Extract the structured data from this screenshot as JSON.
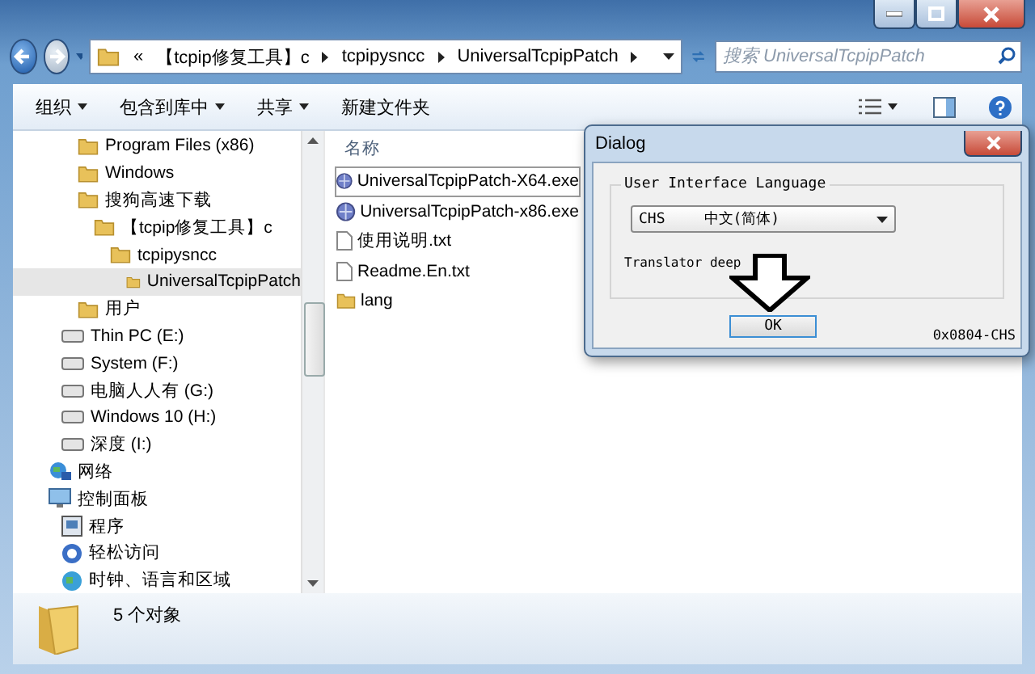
{
  "address": {
    "overflow": "«",
    "crumbs": [
      "【tcpip修复工具】c",
      "tcpipysncc",
      "UniversalTcpipPatch"
    ]
  },
  "search": {
    "placeholder": "搜索 UniversalTcpipPatch"
  },
  "toolbar": [
    {
      "label": "组织",
      "dropdown": true
    },
    {
      "label": "包含到库中",
      "dropdown": true
    },
    {
      "label": "共享",
      "dropdown": true
    },
    {
      "label": "新建文件夹",
      "dropdown": false
    }
  ],
  "sidebar": {
    "items": [
      {
        "kind": "folder",
        "label": "Program Files (x86)",
        "selected": false
      },
      {
        "kind": "folder",
        "label": "Windows",
        "selected": false
      },
      {
        "kind": "folder",
        "label": "搜狗高速下载",
        "selected": false,
        "children": [
          {
            "kind": "folder",
            "label": "【tcpip修复工具】c",
            "selected": false,
            "children": [
              {
                "kind": "folder",
                "label": "tcpipysncc",
                "selected": false,
                "children": [
                  {
                    "kind": "folder",
                    "label": "UniversalTcpipPatch",
                    "selected": true
                  }
                ]
              }
            ]
          }
        ]
      },
      {
        "kind": "folder",
        "label": "用户",
        "selected": false
      },
      {
        "kind": "drive",
        "label": "Thin PC (E:)",
        "selected": false
      },
      {
        "kind": "drive",
        "label": "System (F:)",
        "selected": false
      },
      {
        "kind": "drive",
        "label": "电脑人人有 (G:)",
        "selected": false
      },
      {
        "kind": "drive",
        "label": "Windows 10 (H:)",
        "selected": false
      },
      {
        "kind": "drive",
        "label": "深度 (I:)",
        "selected": false
      },
      {
        "kind": "network",
        "label": "网络",
        "selected": false
      },
      {
        "kind": "control",
        "label": "控制面板",
        "selected": false,
        "children": [
          {
            "kind": "programs",
            "label": "程序",
            "selected": false
          },
          {
            "kind": "access",
            "label": "轻松访问",
            "selected": false
          },
          {
            "kind": "clock",
            "label": "时钟、语言和区域",
            "selected": false
          }
        ]
      }
    ]
  },
  "columns": [
    "名称"
  ],
  "files": [
    {
      "kind": "exe",
      "name": "UniversalTcpipPatch-X64.exe",
      "selected": true
    },
    {
      "kind": "exe",
      "name": "UniversalTcpipPatch-x86.exe",
      "selected": false
    },
    {
      "kind": "txt",
      "name": "使用说明.txt",
      "selected": false
    },
    {
      "kind": "txt",
      "name": "Readme.En.txt",
      "selected": false
    },
    {
      "kind": "folder",
      "name": "lang",
      "selected": false
    }
  ],
  "dialog": {
    "title": "Dialog",
    "group": "User Interface Language",
    "language_code": "CHS",
    "language_name": "中文(简体)",
    "translator": "Translator deep",
    "ok": "OK",
    "code": "0x0804-CHS"
  },
  "status_bar": {
    "count": "5 个对象"
  }
}
